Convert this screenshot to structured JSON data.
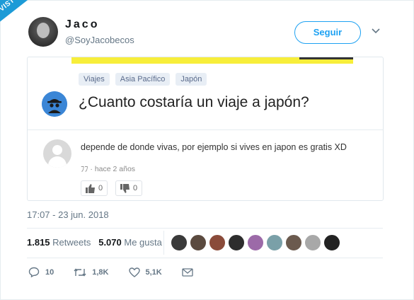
{
  "watermark": "VISTOENLASREDES",
  "author": {
    "name": "Jaco",
    "handle": "@SoyJacobecos"
  },
  "follow_label": "Seguir",
  "card": {
    "tags": [
      "Viajes",
      "Asia Pacífico",
      "Japón"
    ],
    "question": "¿Cuanto costaría un viaje a japón?",
    "answer": "depende de donde vivas, por ejemplo si vives en japon es gratis XD",
    "answer_meta": "ﾌﾌ · hace 2 años",
    "upvotes": "0",
    "downvotes": "0"
  },
  "timestamp": "17:07 - 23 jun. 2018",
  "stats": {
    "retweets": "1.815",
    "retweets_label": "Retweets",
    "likes": "5.070",
    "likes_label": "Me gusta"
  },
  "actions": {
    "replies": "10",
    "retweets": "1,8K",
    "likes": "5,1K"
  },
  "colors": {
    "accent": "#1da1f2",
    "ribbon": "#1d9bd7"
  }
}
